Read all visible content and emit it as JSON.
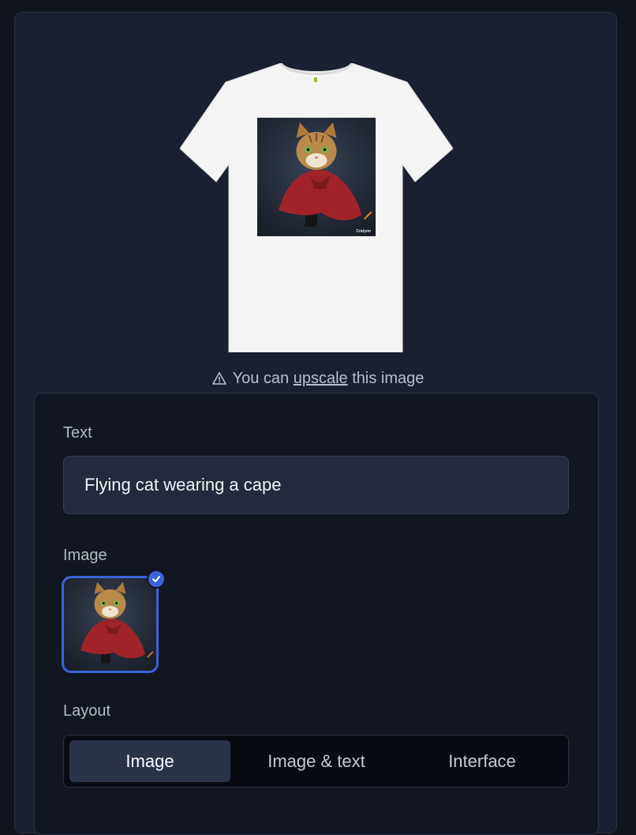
{
  "preview": {
    "print_brand": "Craiyon"
  },
  "upscale_note": {
    "icon": "warning-triangle-icon",
    "prefix": "You can",
    "link": "upscale",
    "suffix": "this image"
  },
  "form": {
    "text_label": "Text",
    "text_value": "Flying cat wearing a cape",
    "image_label": "Image",
    "selected_icon": "check-icon",
    "layout_label": "Layout",
    "layout_options": [
      "Image",
      "Image & text",
      "Interface"
    ],
    "layout_selected": "Image"
  },
  "colors": {
    "accent": "#3b63d9",
    "cape": "#a0232a"
  }
}
